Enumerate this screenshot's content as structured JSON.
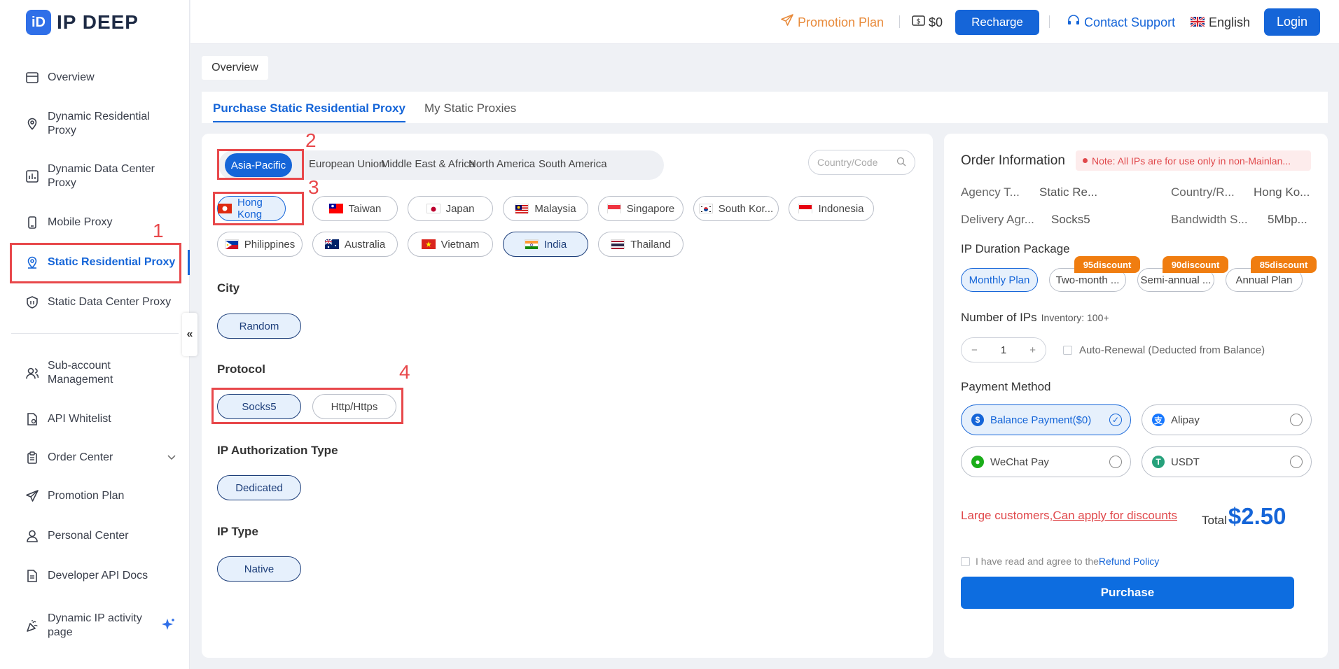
{
  "brand": {
    "name": "IP DEEP",
    "mark": "iD"
  },
  "header": {
    "promotion": "Promotion Plan",
    "balance": "$0",
    "recharge": "Recharge",
    "support": "Contact Support",
    "language": "English",
    "login": "Login"
  },
  "sidebar": {
    "items": [
      {
        "label": "Overview",
        "icon": "dashboard-icon"
      },
      {
        "label": "Dynamic Residential Proxy",
        "icon": "location-icon"
      },
      {
        "label": "Dynamic Data Center Proxy",
        "icon": "chart-icon"
      },
      {
        "label": "Mobile Proxy",
        "icon": "mobile-icon"
      },
      {
        "label": "Static Residential Proxy",
        "icon": "location-icon"
      },
      {
        "label": "Static Data Center Proxy",
        "icon": "shield-icon"
      },
      {
        "label": "Sub-account Management",
        "icon": "users-icon"
      },
      {
        "label": "API Whitelist",
        "icon": "file-icon"
      },
      {
        "label": "Order Center",
        "icon": "clipboard-icon"
      },
      {
        "label": "Promotion Plan",
        "icon": "send-icon"
      },
      {
        "label": "Personal Center",
        "icon": "user-icon"
      },
      {
        "label": "Developer API Docs",
        "icon": "doc-icon"
      },
      {
        "label": "Dynamic IP activity page",
        "icon": "party-icon"
      }
    ],
    "collapse": "«"
  },
  "annotations": [
    "1",
    "2",
    "3",
    "4"
  ],
  "breadcrumb": "Overview",
  "tabs": [
    "Purchase Static Residential Proxy",
    "My Static Proxies"
  ],
  "regions": [
    "Asia-Pacific",
    "European Union",
    "Middle East & Africa",
    "North America",
    "South America"
  ],
  "search_placeholder": "Country/Code",
  "countries": [
    "Hong Kong",
    "Taiwan",
    "Japan",
    "Malaysia",
    "Singapore",
    "South Kor...",
    "Indonesia",
    "Philippines",
    "Australia",
    "Vietnam",
    "India",
    "Thailand"
  ],
  "sections": {
    "city": {
      "title": "City",
      "options": [
        "Random"
      ]
    },
    "protocol": {
      "title": "Protocol",
      "options": [
        "Socks5",
        "Http/Https"
      ]
    },
    "auth": {
      "title": "IP Authorization Type",
      "options": [
        "Dedicated"
      ]
    },
    "iptype": {
      "title": "IP Type",
      "options": [
        "Native"
      ]
    }
  },
  "order": {
    "title": "Order Information",
    "note": "Note: All IPs are for use only in non-Mainlan...",
    "info": [
      {
        "k": "Agency T...",
        "v": "Static Re..."
      },
      {
        "k": "Country/R...",
        "v": "Hong Ko..."
      },
      {
        "k": "Delivery Agr...",
        "v": "Socks5"
      },
      {
        "k": "Bandwidth S...",
        "v": "5Mbp..."
      }
    ],
    "duration_title": "IP Duration Package",
    "plans": [
      "Monthly Plan",
      "Two-month ...",
      "Semi-annual ...",
      "Annual Plan"
    ],
    "badges": [
      "95discount",
      "90discount",
      "85discount"
    ],
    "ips_title": "Number of IPs",
    "inventory": "Inventory: 100+",
    "quantity": "1",
    "minus": "−",
    "plus": "+",
    "autorenew": "Auto-Renewal (Deducted from Balance)",
    "payment_title": "Payment Method",
    "payments": [
      "Balance Payment($0)",
      "Alipay",
      "WeChat Pay",
      "USDT"
    ],
    "large_prefix": "Large customers,",
    "large_link": "Can apply for discounts",
    "total_label": "Total",
    "total_amount": "$2.50",
    "agree_prefix": "I have read and agree to the",
    "agree_link": "Refund Policy",
    "purchase": "Purchase"
  },
  "colors": {
    "accent": "#1565d8",
    "promo": "#e88a3a",
    "badge": "#f07d10",
    "annotation": "#e8484b"
  }
}
